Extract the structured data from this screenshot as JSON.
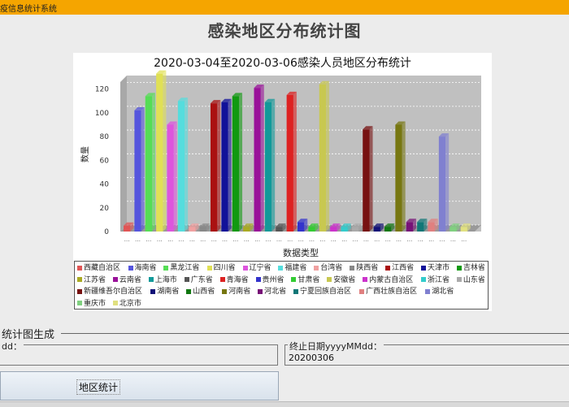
{
  "window": {
    "title": "疫信息统计系统"
  },
  "page_title": "感染地区分布统计图",
  "chart_data": {
    "type": "bar",
    "title": "2020-03-04至2020-03-06感染人员地区分布统计",
    "xlabel": "数据类型",
    "ylabel": "数量",
    "ylim": [
      0,
      130
    ],
    "yticks": [
      "0",
      "20",
      "40",
      "60",
      "80",
      "100",
      "120"
    ],
    "tick_label_text": "…",
    "grid": true,
    "legend_position": "bottom",
    "series": [
      {
        "name": "西藏自治区",
        "value": 5,
        "color": "#e05555"
      },
      {
        "name": "海南省",
        "value": 102,
        "color": "#5555dd"
      },
      {
        "name": "黑龙江省",
        "value": 114,
        "color": "#55dd55"
      },
      {
        "name": "四川省",
        "value": 133,
        "color": "#e0e055"
      },
      {
        "name": "辽宁省",
        "value": 90,
        "color": "#dd55dd"
      },
      {
        "name": "福建省",
        "value": 110,
        "color": "#55dddd"
      },
      {
        "name": "台湾省",
        "value": 4,
        "color": "#f0a0a0"
      },
      {
        "name": "陕西省",
        "value": 4,
        "color": "#888888"
      },
      {
        "name": "江西省",
        "value": 108,
        "color": "#aa1111"
      },
      {
        "name": "天津市",
        "value": 109,
        "color": "#111199"
      },
      {
        "name": "吉林省",
        "value": 114,
        "color": "#119911"
      },
      {
        "name": "江苏省",
        "value": 4,
        "color": "#aaaa22"
      },
      {
        "name": "云南省",
        "value": 121,
        "color": "#991199"
      },
      {
        "name": "上海市",
        "value": 109,
        "color": "#119999"
      },
      {
        "name": "广东省",
        "value": 4,
        "color": "#555555"
      },
      {
        "name": "青海省",
        "value": 115,
        "color": "#dd2222"
      },
      {
        "name": "贵州省",
        "value": 8,
        "color": "#3333cc"
      },
      {
        "name": "甘肃省",
        "value": 4,
        "color": "#33cc33"
      },
      {
        "name": "安徽省",
        "value": 124,
        "color": "#c8c850"
      },
      {
        "name": "内蒙古自治区",
        "value": 4,
        "color": "#cc33cc"
      },
      {
        "name": "浙江省",
        "value": 4,
        "color": "#33cccc"
      },
      {
        "name": "山东省",
        "value": 4,
        "color": "#aaaaaa"
      },
      {
        "name": "新疆维吾尔自治区",
        "value": 86,
        "color": "#771111"
      },
      {
        "name": "湖南省",
        "value": 4,
        "color": "#111177"
      },
      {
        "name": "山西省",
        "value": 4,
        "color": "#117711"
      },
      {
        "name": "河南省",
        "value": 90,
        "color": "#777711"
      },
      {
        "name": "河北省",
        "value": 8,
        "color": "#771177"
      },
      {
        "name": "宁夏回族自治区",
        "value": 8,
        "color": "#117777"
      },
      {
        "name": "广西壮族自治区",
        "value": 8,
        "color": "#e08080"
      },
      {
        "name": "湖北省",
        "value": 80,
        "color": "#8080d0"
      },
      {
        "name": "重庆市",
        "value": 4,
        "color": "#80d080"
      },
      {
        "name": "北京市",
        "value": 4,
        "color": "#e0e080"
      }
    ]
  },
  "form": {
    "section_title": "统计图生成",
    "start_date_label": "dd：",
    "start_date_value": "",
    "end_date_label": "终止日期yyyyMMdd：",
    "end_date_value": "20200306",
    "submit_label": "地区统计"
  }
}
